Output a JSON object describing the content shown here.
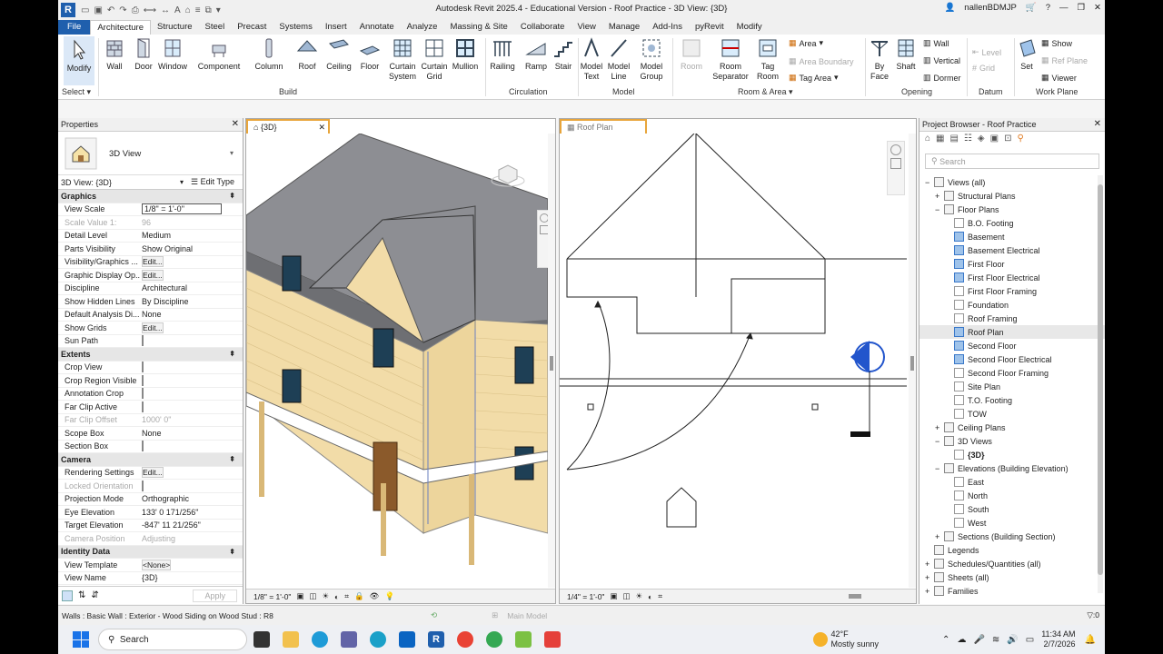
{
  "title": "Autodesk Revit 2025.4 - Educational Version - Roof Practice - 3D View: {3D}",
  "user": "nallenBDMJP",
  "tabs": [
    "File",
    "Architecture",
    "Structure",
    "Steel",
    "Precast",
    "Systems",
    "Insert",
    "Annotate",
    "Analyze",
    "Massing & Site",
    "Collaborate",
    "View",
    "Manage",
    "Add-Ins",
    "pyRevit",
    "Modify"
  ],
  "ribbon": {
    "select": {
      "modify": "Modify",
      "label": "Select"
    },
    "build": {
      "label": "Build",
      "wall": "Wall",
      "door": "Door",
      "window": "Window",
      "component": "Component",
      "column": "Column",
      "roof": "Roof",
      "ceiling": "Ceiling",
      "floor": "Floor",
      "curtain_system": "Curtain System",
      "curtain_grid": "Curtain Grid",
      "mullion": "Mullion"
    },
    "circulation": {
      "label": "Circulation",
      "railing": "Railing",
      "ramp": "Ramp",
      "stair": "Stair"
    },
    "model": {
      "label": "Model",
      "model_text": "Model Text",
      "model_line": "Model Line",
      "model_group": "Model Group"
    },
    "room_area": {
      "label": "Room & Area",
      "room": "Room",
      "room_separator": "Room Separator",
      "tag_room": "Tag Room",
      "area": "Area",
      "area_boundary": "Area Boundary",
      "tag_area": "Tag Area"
    },
    "opening": {
      "label": "Opening",
      "by_face": "By Face",
      "shaft": "Shaft",
      "wall": "Wall",
      "vertical": "Vertical",
      "dormer": "Dormer"
    },
    "datum": {
      "label": "Datum",
      "level": "Level",
      "grid": "Grid"
    },
    "work_plane": {
      "label": "Work Plane",
      "set": "Set",
      "show": "Show",
      "ref_plane": "Ref Plane",
      "viewer": "Viewer"
    }
  },
  "properties": {
    "title": "Properties",
    "type_name": "3D View",
    "selector": "3D View: {3D}",
    "edit_type": "Edit Type",
    "groups": [
      {
        "name": "Graphics",
        "rows": [
          {
            "k": "View Scale",
            "v": "1/8\" = 1'-0\"",
            "kind": "input"
          },
          {
            "k": "Scale Value    1:",
            "v": "96",
            "dim": true
          },
          {
            "k": "Detail Level",
            "v": "Medium"
          },
          {
            "k": "Parts Visibility",
            "v": "Show Original"
          },
          {
            "k": "Visibility/Graphics ...",
            "v": "Edit...",
            "kind": "button"
          },
          {
            "k": "Graphic Display Op...",
            "v": "Edit...",
            "kind": "button"
          },
          {
            "k": "Discipline",
            "v": "Architectural"
          },
          {
            "k": "Show Hidden Lines",
            "v": "By Discipline"
          },
          {
            "k": "Default Analysis Di...",
            "v": "None"
          },
          {
            "k": "Show Grids",
            "v": "Edit...",
            "kind": "button"
          },
          {
            "k": "Sun Path",
            "v": "",
            "kind": "check"
          }
        ]
      },
      {
        "name": "Extents",
        "rows": [
          {
            "k": "Crop View",
            "v": "",
            "kind": "check"
          },
          {
            "k": "Crop Region Visible",
            "v": "",
            "kind": "check"
          },
          {
            "k": "Annotation Crop",
            "v": "",
            "kind": "check"
          },
          {
            "k": "Far Clip Active",
            "v": "",
            "kind": "check"
          },
          {
            "k": "Far Clip Offset",
            "v": "1000'  0\"",
            "dim": true
          },
          {
            "k": "Scope Box",
            "v": "None"
          },
          {
            "k": "Section Box",
            "v": "",
            "kind": "check"
          }
        ]
      },
      {
        "name": "Camera",
        "rows": [
          {
            "k": "Rendering Settings",
            "v": "Edit...",
            "kind": "button"
          },
          {
            "k": "Locked Orientation",
            "v": "",
            "kind": "check",
            "dim": true
          },
          {
            "k": "Projection Mode",
            "v": "Orthographic"
          },
          {
            "k": "Eye Elevation",
            "v": "133'  0 171/256\""
          },
          {
            "k": "Target Elevation",
            "v": "-847'  11 21/256\""
          },
          {
            "k": "Camera Position",
            "v": "Adjusting",
            "dim": true
          }
        ]
      },
      {
        "name": "Identity Data",
        "rows": [
          {
            "k": "View Template",
            "v": "<None>",
            "kind": "button"
          },
          {
            "k": "View Name",
            "v": "{3D}"
          }
        ]
      }
    ],
    "apply": "Apply"
  },
  "view3d": {
    "tab": "{3D}",
    "scale": "1/8\" = 1'-0\""
  },
  "viewroof": {
    "tab": "Roof Plan",
    "scale": "1/4\" = 1'-0\""
  },
  "browser": {
    "title": "Project Browser - Roof Practice",
    "search_placeholder": "Search",
    "nodes": [
      {
        "label": "Views (all)",
        "lvl": 0,
        "exp": "−"
      },
      {
        "label": "Structural Plans",
        "lvl": 1,
        "exp": "+"
      },
      {
        "label": "Floor Plans",
        "lvl": 1,
        "exp": "−"
      },
      {
        "label": "B.O. Footing",
        "lvl": 2
      },
      {
        "label": "Basement",
        "lvl": 2,
        "blue": true
      },
      {
        "label": "Basement Electrical",
        "lvl": 2,
        "blue": true
      },
      {
        "label": "First Floor",
        "lvl": 2,
        "blue": true
      },
      {
        "label": "First Floor Electrical",
        "lvl": 2,
        "blue": true
      },
      {
        "label": "First Floor Framing",
        "lvl": 2
      },
      {
        "label": "Foundation",
        "lvl": 2
      },
      {
        "label": "Roof Framing",
        "lvl": 2
      },
      {
        "label": "Roof Plan",
        "lvl": 2,
        "blue": true,
        "sel": true
      },
      {
        "label": "Second Floor",
        "lvl": 2,
        "blue": true
      },
      {
        "label": "Second Floor Electrical",
        "lvl": 2,
        "blue": true
      },
      {
        "label": "Second Floor Framing",
        "lvl": 2
      },
      {
        "label": "Site Plan",
        "lvl": 2
      },
      {
        "label": "T.O. Footing",
        "lvl": 2
      },
      {
        "label": "TOW",
        "lvl": 2
      },
      {
        "label": "Ceiling Plans",
        "lvl": 1,
        "exp": "+"
      },
      {
        "label": "3D Views",
        "lvl": 1,
        "exp": "−"
      },
      {
        "label": "{3D}",
        "lvl": 2,
        "bold": true
      },
      {
        "label": "Elevations (Building Elevation)",
        "lvl": 1,
        "exp": "−"
      },
      {
        "label": "East",
        "lvl": 2
      },
      {
        "label": "North",
        "lvl": 2
      },
      {
        "label": "South",
        "lvl": 2
      },
      {
        "label": "West",
        "lvl": 2
      },
      {
        "label": "Sections (Building Section)",
        "lvl": 1,
        "exp": "+"
      },
      {
        "label": "Legends",
        "lvl": 0
      },
      {
        "label": "Schedules/Quantities (all)",
        "lvl": 0,
        "exp": "+"
      },
      {
        "label": "Sheets (all)",
        "lvl": 0,
        "exp": "+"
      },
      {
        "label": "Families",
        "lvl": 0,
        "exp": "+"
      }
    ]
  },
  "status": {
    "text": "Walls : Basic Wall : Exterior - Wood Siding on Wood Stud : R8",
    "model": "Main Model",
    "count": ":0"
  },
  "taskbar": {
    "search": "Search",
    "weather_temp": "42°F",
    "weather_desc": "Mostly sunny",
    "time": "11:34 AM",
    "date": "2/7/2026"
  }
}
